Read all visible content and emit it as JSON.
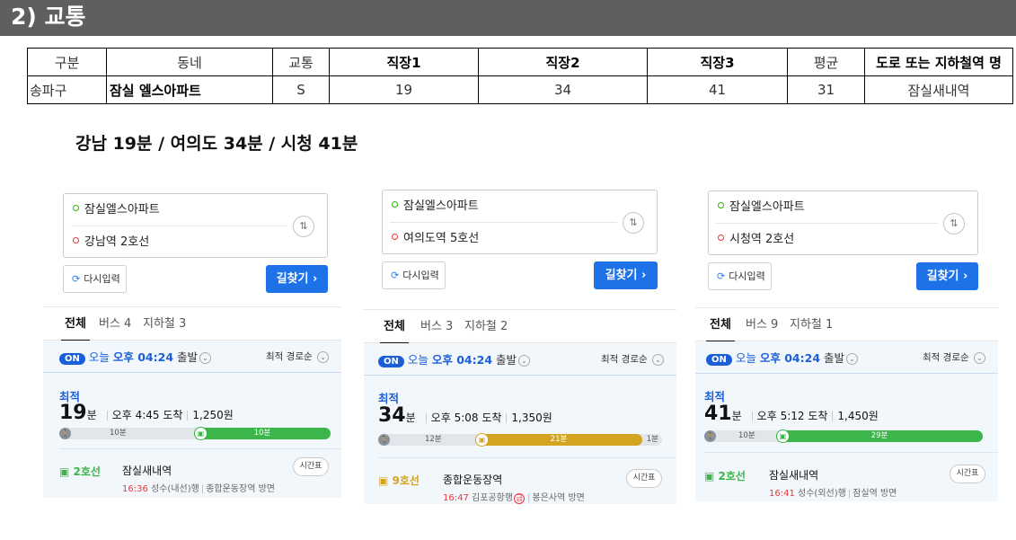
{
  "section": {
    "title": "2) 교통"
  },
  "table": {
    "headers": [
      "구분",
      "동네",
      "교통",
      "직장1",
      "직장2",
      "직장3",
      "평균",
      "도로 또는 지하철역 명"
    ],
    "row": [
      "송파구",
      "잠실 엘스아파트",
      "S",
      "19",
      "34",
      "41",
      "31",
      "잠실새내역"
    ]
  },
  "headline": "강남 19분 / 여의도 34분 / 시청 41분",
  "common": {
    "reset_label": "다시입력",
    "find_label": "길찾기",
    "find_arrow": "›",
    "tab_all": "전체",
    "on_badge": "ON",
    "today": "오늘",
    "depart_time": "오후 04:24",
    "depart_suffix": "출발",
    "sort_label": "최적 경로순",
    "best_label": "최적",
    "min_unit": "분",
    "timetable_label": "시간표"
  },
  "panels": [
    {
      "origin": "잠실엘스아파트",
      "destination": "강남역 2호선",
      "tab_bus": "버스 4",
      "tab_subway": "지하철 3",
      "total_min": "19",
      "arrival": "오후 4:45 도착",
      "fare": "1,250원",
      "walk_label": "10분",
      "ride_label": "10분",
      "after_label": "",
      "line": "2호선",
      "line_color": "#3cb54a",
      "station": "잠실새내역",
      "next_time": "16:36",
      "next_dest": "성수(내선)행",
      "direction": "종합운동장역 방면",
      "express": ""
    },
    {
      "origin": "잠실엘스아파트",
      "destination": "여의도역 5호선",
      "tab_bus": "버스 3",
      "tab_subway": "지하철 2",
      "total_min": "34",
      "arrival": "오후 5:08 도착",
      "fare": "1,350원",
      "walk_label": "12분",
      "ride_label": "21분",
      "after_label": "1분",
      "line": "9호선",
      "line_color": "#d4a421",
      "station": "종합운동장역",
      "next_time": "16:47",
      "next_dest": "김포공항행",
      "direction": "봉은사역 방면",
      "express": "급"
    },
    {
      "origin": "잠실엘스아파트",
      "destination": "시청역 2호선",
      "tab_bus": "버스 9",
      "tab_subway": "지하철 1",
      "total_min": "41",
      "arrival": "오후 5:12 도착",
      "fare": "1,450원",
      "walk_label": "10분",
      "ride_label": "29분",
      "after_label": "",
      "line": "2호선",
      "line_color": "#3cb54a",
      "station": "잠실새내역",
      "next_time": "16:41",
      "next_dest": "성수(외선)행",
      "direction": "잠실역 방면",
      "express": ""
    }
  ]
}
